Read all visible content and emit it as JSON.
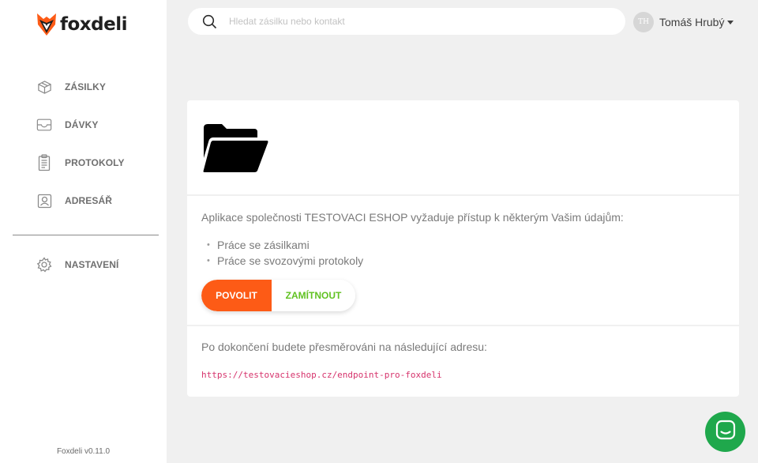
{
  "brand": {
    "name": "foxdeli",
    "accent": "#fd5b16"
  },
  "sidebar": {
    "items": [
      {
        "label": "ZÁSILKY",
        "icon": "package-icon"
      },
      {
        "label": "DÁVKY",
        "icon": "inbox-tray-icon"
      },
      {
        "label": "PROTOKOLY",
        "icon": "clipboard-icon"
      },
      {
        "label": "ADRESÁŘ",
        "icon": "address-book-icon"
      }
    ],
    "settings": {
      "label": "NASTAVENÍ",
      "icon": "gear-icon"
    },
    "version": "Foxdeli v0.11.0"
  },
  "search": {
    "placeholder": "Hledat zásilku nebo kontakt",
    "value": ""
  },
  "user": {
    "initials": "TH",
    "name": "Tomáš Hrubý"
  },
  "consent": {
    "icon": "folder-open-icon",
    "description": "Aplikace společnosti TESTOVACI ESHOP vyžaduje přístup k některým Vašim údajům:",
    "permissions": [
      "Práce se zásilkami",
      "Práce se svozovými protokoly"
    ],
    "allow_label": "POVOLIT",
    "deny_label": "ZAMÍTNOUT",
    "redirect_text": "Po dokončení budete přesměrováni na následující adresu:",
    "redirect_url": "https://testovacieshop.cz/endpoint-pro-foxdeli"
  },
  "chat": {
    "icon": "chat-icon",
    "color": "#1fa84c"
  }
}
